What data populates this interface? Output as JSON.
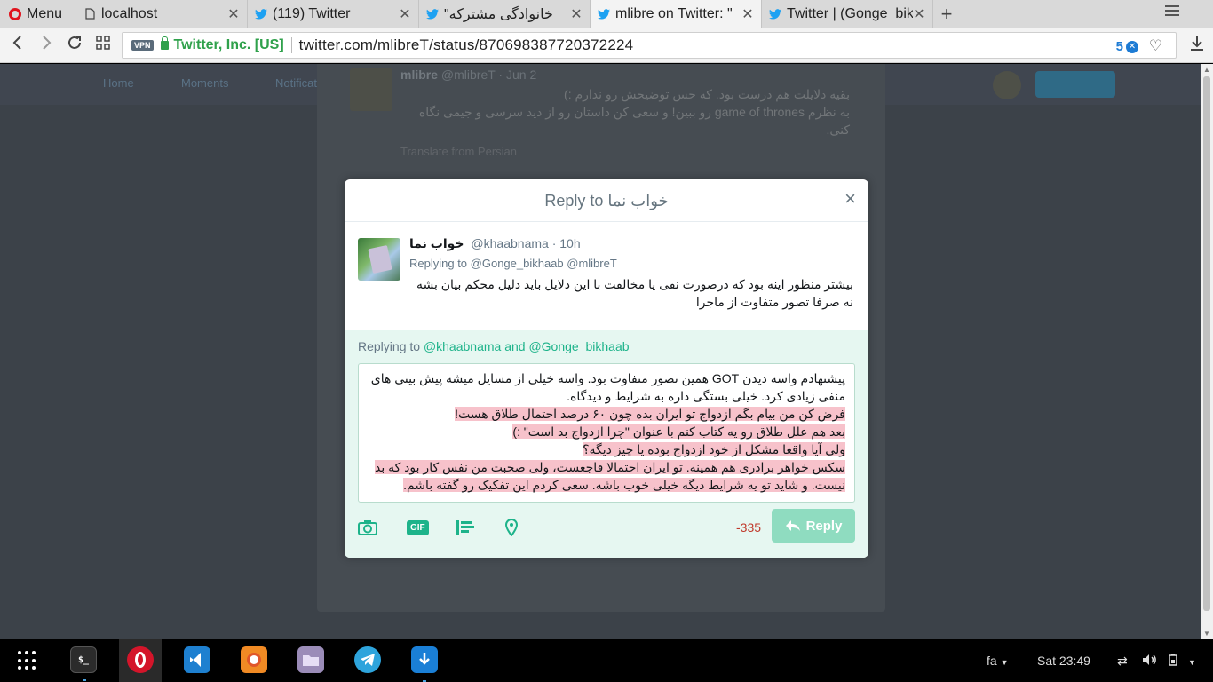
{
  "browser": {
    "menu_label": "Menu",
    "tabs": [
      {
        "title": "localhost",
        "icon": "document-icon",
        "active": false
      },
      {
        "title": "(119) Twitter",
        "icon": "twitter-bird-icon",
        "active": false
      },
      {
        "title": "خانوادگی مشترکه\"",
        "icon": "twitter-bird-icon",
        "active": false
      },
      {
        "title": "mlibre on Twitter: \"",
        "icon": "twitter-bird-icon",
        "active": true
      },
      {
        "title": "Twitter | (Gonge_bik",
        "icon": "twitter-bird-icon",
        "active": false
      }
    ],
    "vpn_label": "VPN",
    "cert_label": "Twitter, Inc. [US]",
    "url": "twitter.com/mlibreT/status/870698387720372224",
    "adblock_count": "5"
  },
  "background": {
    "nav": [
      "Home",
      "Moments",
      "Notifications"
    ],
    "tweet_name": "mlibre",
    "tweet_handle": "@mlibreT · Jun 2",
    "tweet_lines": [
      "بقیه دلایلت هم درست بود. که حس توضیحش رو ندارم :)",
      "به نظرم game of thrones رو ببین! و سعی کن داستان رو از دید سرسی و جیمی نگاه",
      "کنی."
    ],
    "translate_label": "Translate from Persian"
  },
  "modal": {
    "title": "Reply to خواب نما",
    "close_label": "×",
    "original": {
      "display_name": "خواب نما",
      "handle_time": "@khaabnama · 10h",
      "replying_to": "Replying to @Gonge_bikhaab @mlibreT",
      "text_lines": [
        "بیشتر منظور اینه بود که درصورت نفی یا مخالفت با این دلایل باید دلیل محکم بیان بشه",
        "نه صرفا تصور متفاوت از ماجرا"
      ]
    },
    "compose": {
      "replying_prefix": "Replying to ",
      "replying_users": "@khaabnama and @Gonge_bikhaab",
      "lines": [
        {
          "text": "پیشنهادم واسه دیدن GOT همین تصور متفاوت بود. واسه خیلی از مسایل میشه پیش بینی های",
          "over": false
        },
        {
          "text": "منفی زیادی کرد. خیلی بستگی داره به شرایط و دیدگاه.",
          "over": false
        },
        {
          "text": "فرض کن من بیام بگم ازدواج تو ایران بده چون ۶۰ درصد احتمال طلاق هست!",
          "over": true
        },
        {
          "text": "بعد هم علل طلاق رو یه کتاب کنم با عنوان \"چرا ازدواج بد است\" :)",
          "over": true
        },
        {
          "text": "ولی آیا واقعا مشکل از خود ازدواج بوده یا چیز دیگه؟",
          "over": true
        },
        {
          "text": "سکس خواهر برادری هم همینه. تو ایران احتمالا فاجعست، ولی صحبت من نفس کار بود که بد",
          "over": true
        },
        {
          "text": "نیست. و شاید تو یه شرایط دیگه خیلی خوب باشه. سعی کردم این تفکیک رو گفته باشم.",
          "over": true
        }
      ],
      "counter": "-335",
      "reply_label": "Reply",
      "tools": [
        "camera-icon",
        "gif-icon",
        "poll-icon",
        "location-pin-icon"
      ],
      "gif_label": "GIF"
    }
  },
  "taskbar": {
    "apps": [
      "terminal-icon",
      "opera-icon",
      "vscode-icon",
      "firefox-icon",
      "files-icon",
      "telegram-icon",
      "download-manager-icon"
    ],
    "keyboard_layout": "fa",
    "clock": "Sat 23:49"
  },
  "colors": {
    "accent_green": "#1db38a",
    "overflow_highlight": "#f7c2cb",
    "counter_red": "#c0392b"
  }
}
